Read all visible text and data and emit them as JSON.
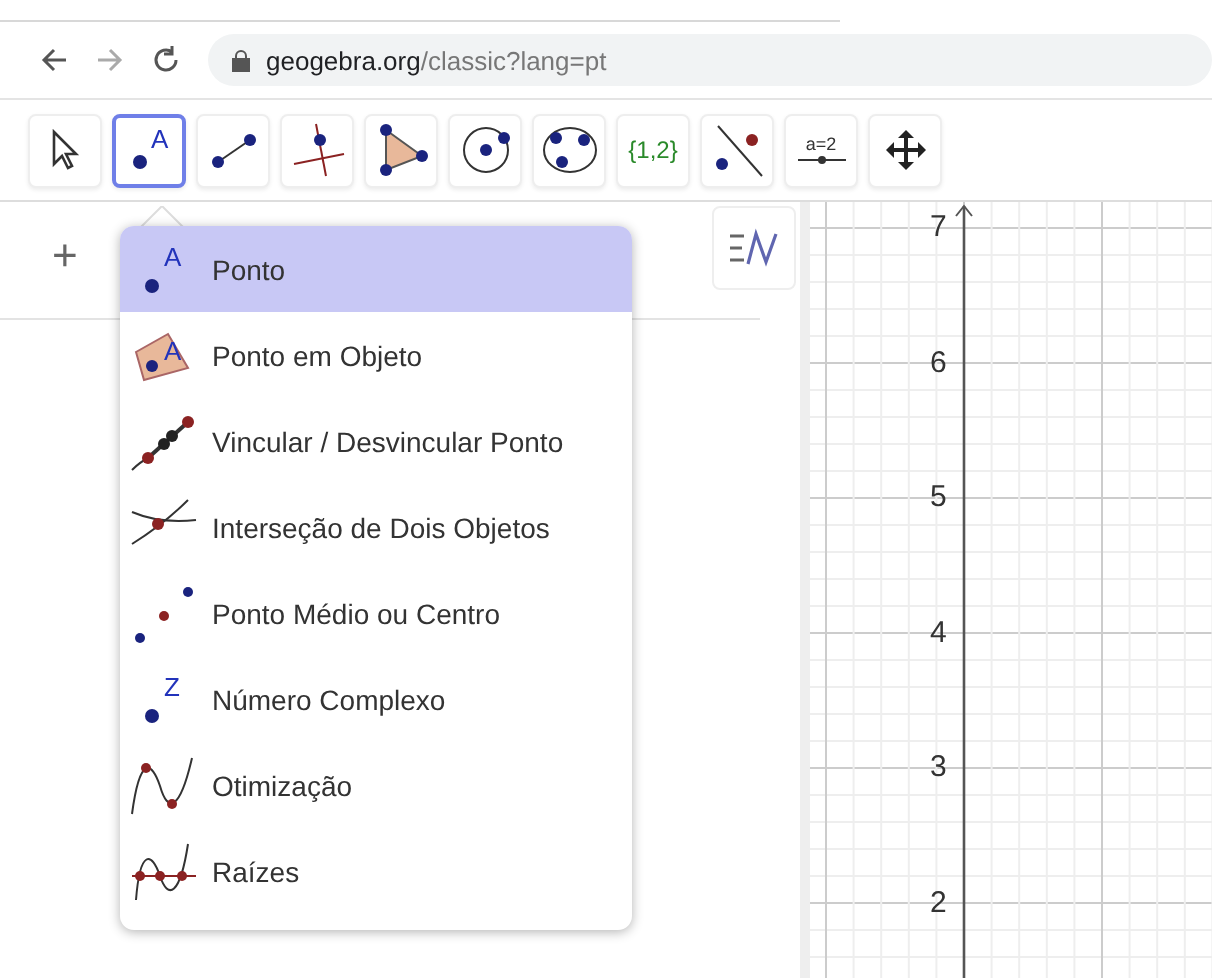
{
  "browser": {
    "url_host": "geogebra.org",
    "url_path": "/classic?lang=pt"
  },
  "toolbar": [
    {
      "kind": "move",
      "selected": false
    },
    {
      "kind": "point",
      "selected": true,
      "label": "A"
    },
    {
      "kind": "segment",
      "selected": false
    },
    {
      "kind": "perpendicular",
      "selected": false
    },
    {
      "kind": "polygon",
      "selected": false
    },
    {
      "kind": "circle",
      "selected": false
    },
    {
      "kind": "circle3",
      "selected": false
    },
    {
      "kind": "list",
      "selected": false,
      "label": "{1,2}"
    },
    {
      "kind": "reflect",
      "selected": false
    },
    {
      "kind": "slider",
      "selected": false,
      "label": "a=2"
    },
    {
      "kind": "pan",
      "selected": false
    }
  ],
  "algebra": {
    "add": "+"
  },
  "menu": [
    {
      "kind": "point",
      "label": "Ponto",
      "icon_letter": "A",
      "selected": true
    },
    {
      "kind": "point_on",
      "label": "Ponto em Objeto",
      "icon_letter": "A",
      "selected": false
    },
    {
      "kind": "attach",
      "label": "Vincular / Desvincular Ponto",
      "selected": false
    },
    {
      "kind": "intersect",
      "label": "Interseção de Dois Objetos",
      "selected": false
    },
    {
      "kind": "midpoint",
      "label": "Ponto Médio ou Centro",
      "selected": false
    },
    {
      "kind": "complex",
      "label": "Número Complexo",
      "icon_letter": "Z",
      "selected": false
    },
    {
      "kind": "optimize",
      "label": "Otimização",
      "selected": false
    },
    {
      "kind": "roots",
      "label": "Raízes",
      "selected": false
    }
  ],
  "graphics": {
    "y_labels": [
      "7",
      "6",
      "5",
      "4",
      "3",
      "2"
    ]
  }
}
